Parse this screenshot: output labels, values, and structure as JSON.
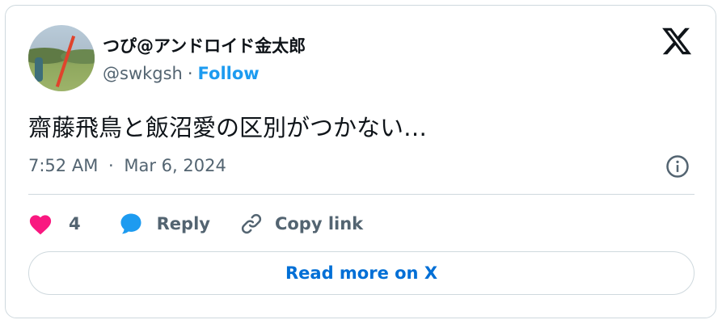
{
  "author": {
    "display_name": "つぴ@アンドロイド金太郎",
    "handle": "@swkgsh",
    "separator": "·",
    "follow_label": "Follow"
  },
  "tweet": {
    "text": "齋藤飛鳥と飯沼愛の区別がつかない…",
    "time": "7:52 AM",
    "date": "Mar 6, 2024",
    "meta_separator": "·"
  },
  "actions": {
    "like_count": "4",
    "reply_label": "Reply",
    "copy_link_label": "Copy link"
  },
  "read_more_label": "Read more on X",
  "colors": {
    "accent": "#1d9bf0",
    "like": "#f91880",
    "link_button_text": "#006fd6",
    "secondary_text": "#536471",
    "border": "#cfd9de"
  },
  "icons": {
    "brand": "x-logo-icon",
    "info": "info-icon",
    "like": "heart-icon",
    "reply": "speech-bubble-icon",
    "copy": "link-icon"
  }
}
